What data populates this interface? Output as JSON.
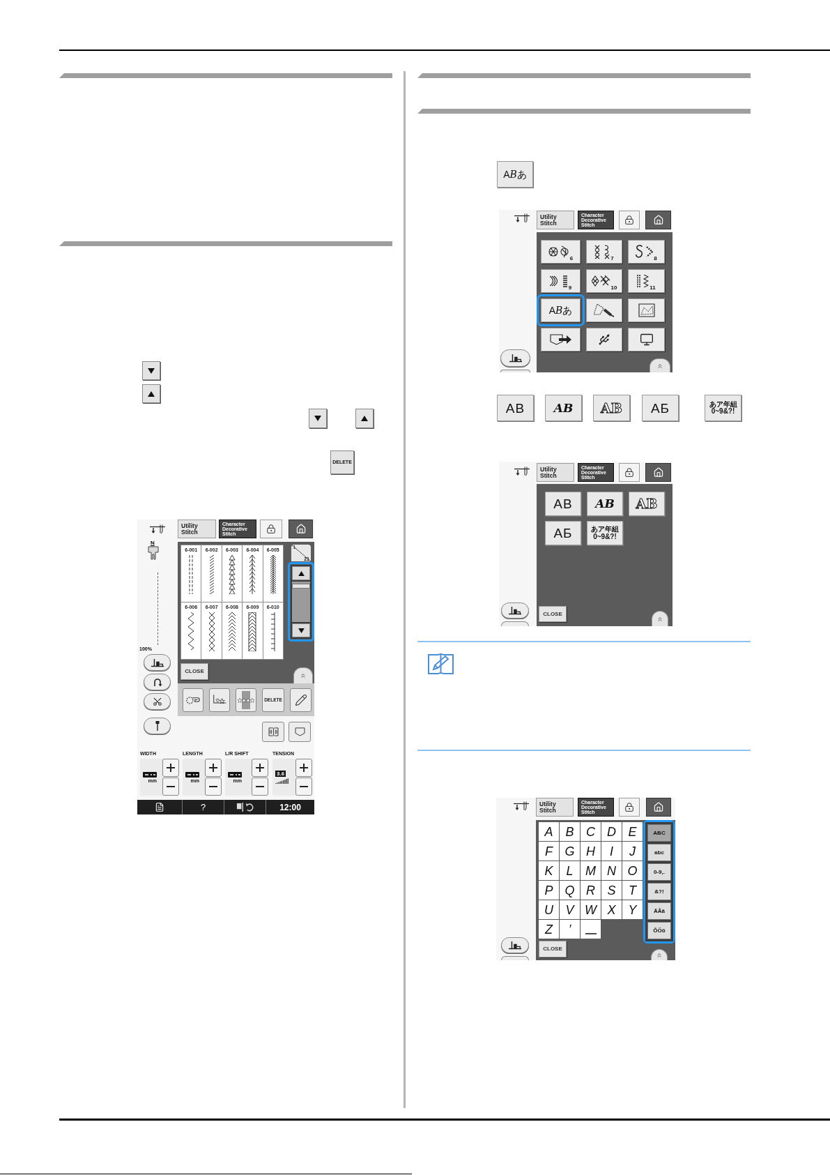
{
  "left_column": {
    "delete_key": "DELETE"
  },
  "stitch_screen": {
    "tabs": [
      {
        "lines": [
          "Utility",
          "Stitch"
        ],
        "selected": false
      },
      {
        "lines": [
          "Character",
          "Decorative",
          "Stitch"
        ],
        "selected": true
      }
    ],
    "presser_foot": "N",
    "zoom": "100%",
    "page": {
      "current": "1",
      "total": "21"
    },
    "stitches": [
      {
        "number": "6-001",
        "kind": "running"
      },
      {
        "number": "6-002",
        "kind": "rope"
      },
      {
        "number": "6-003",
        "kind": "chain"
      },
      {
        "number": "6-004",
        "kind": "feather"
      },
      {
        "number": "6-005",
        "kind": "arrow"
      },
      {
        "number": "6-006",
        "kind": "zigzag"
      },
      {
        "number": "6-007",
        "kind": "cross"
      },
      {
        "number": "6-008",
        "kind": "chevron"
      },
      {
        "number": "6-009",
        "kind": "boxed"
      },
      {
        "number": "6-010",
        "kind": "ladder"
      }
    ],
    "scroll_highlighted": true,
    "close": "CLOSE",
    "tool_delete": "DELETE",
    "settings": [
      {
        "label": "WIDTH",
        "kind": "blank",
        "unit": "mm"
      },
      {
        "label": "LENGTH",
        "kind": "blank",
        "unit": "mm"
      },
      {
        "label": "L/R SHIFT",
        "kind": "blank",
        "unit": "mm"
      },
      {
        "label": "TENSION",
        "kind": "tension",
        "value": "3.6"
      }
    ],
    "status_bar": {
      "help": "?",
      "time": "12:00"
    }
  },
  "category_key": {
    "parts": [
      {
        "text": "A",
        "kind": "plain"
      },
      {
        "text": "B",
        "kind": "script"
      },
      {
        "text": "あ",
        "kind": "plain"
      }
    ]
  },
  "category_screen": {
    "tabs": [
      {
        "lines": [
          "Utility",
          "Stitch"
        ],
        "selected": false
      },
      {
        "lines": [
          "Character",
          "Decorative",
          "Stitch"
        ],
        "selected": true
      }
    ],
    "categories": [
      {
        "kind": "motif",
        "number": "6",
        "highlighted": false
      },
      {
        "kind": "cross",
        "number": "7",
        "highlighted": false
      },
      {
        "kind": "scroll",
        "number": "8",
        "highlighted": false
      },
      {
        "kind": "satin",
        "number": "9",
        "highlighted": false
      },
      {
        "kind": "lattice",
        "number": "10",
        "highlighted": false
      },
      {
        "kind": "zigzag",
        "number": "11",
        "highlighted": false
      },
      {
        "kind": "characters",
        "parts": [
          {
            "text": "A",
            "kind": "plain"
          },
          {
            "text": "B",
            "kind": "script"
          },
          {
            "text": "あ",
            "kind": "plain"
          }
        ],
        "highlighted": true
      },
      {
        "kind": "pen",
        "highlighted": false
      },
      {
        "kind": "picture",
        "highlighted": false
      },
      {
        "kind": "pocket",
        "highlighted": false
      },
      {
        "kind": "usb",
        "highlighted": false
      },
      {
        "kind": "computer",
        "highlighted": false
      }
    ]
  },
  "font_keys": [
    {
      "kind": "sans",
      "lines": [
        "AB"
      ]
    },
    {
      "kind": "script",
      "lines": [
        "AB"
      ]
    },
    {
      "kind": "outline",
      "lines": [
        "AB"
      ]
    },
    {
      "kind": "sans",
      "lines": [
        "АБ"
      ]
    },
    {
      "kind": "small",
      "lines": [
        "あア年組",
        "0~9&?!"
      ]
    }
  ],
  "font_screen": {
    "tabs": [
      {
        "lines": [
          "Utility",
          "Stitch"
        ],
        "selected": false
      },
      {
        "lines": [
          "Character",
          "Decorative",
          "Stitch"
        ],
        "selected": true
      }
    ],
    "fonts": [
      {
        "kind": "sans",
        "lines": [
          "AB"
        ]
      },
      {
        "kind": "script",
        "lines": [
          "AB"
        ]
      },
      {
        "kind": "outline",
        "lines": [
          "AB"
        ]
      },
      {
        "kind": "sans",
        "lines": [
          "АБ"
        ]
      },
      {
        "kind": "small",
        "lines": [
          "あア年組",
          "0~9&?!"
        ]
      }
    ],
    "close": "CLOSE"
  },
  "letter_screen": {
    "tabs": [
      {
        "lines": [
          "Utility",
          "Stitch"
        ],
        "selected": false
      },
      {
        "lines": [
          "Character",
          "Decorative",
          "Stitch"
        ],
        "selected": true
      }
    ],
    "keys": [
      {
        "kind": "char",
        "label": "A"
      },
      {
        "kind": "char",
        "label": "B"
      },
      {
        "kind": "char",
        "label": "C"
      },
      {
        "kind": "char",
        "label": "D"
      },
      {
        "kind": "char",
        "label": "E"
      },
      {
        "kind": "char",
        "label": "F"
      },
      {
        "kind": "char",
        "label": "G"
      },
      {
        "kind": "char",
        "label": "H"
      },
      {
        "kind": "char",
        "label": "I"
      },
      {
        "kind": "char",
        "label": "J"
      },
      {
        "kind": "char",
        "label": "K"
      },
      {
        "kind": "char",
        "label": "L"
      },
      {
        "kind": "char",
        "label": "M"
      },
      {
        "kind": "char",
        "label": "N"
      },
      {
        "kind": "char",
        "label": "O"
      },
      {
        "kind": "char",
        "label": "P"
      },
      {
        "kind": "char",
        "label": "Q"
      },
      {
        "kind": "char",
        "label": "R"
      },
      {
        "kind": "char",
        "label": "S"
      },
      {
        "kind": "char",
        "label": "T"
      },
      {
        "kind": "char",
        "label": "U"
      },
      {
        "kind": "char",
        "label": "V"
      },
      {
        "kind": "char",
        "label": "W"
      },
      {
        "kind": "char",
        "label": "X"
      },
      {
        "kind": "char",
        "label": "Y"
      },
      {
        "kind": "char",
        "label": "Z"
      },
      {
        "kind": "char",
        "label": "’"
      },
      {
        "kind": "space"
      }
    ],
    "types": [
      {
        "label": "ABC",
        "selected": true
      },
      {
        "label": "abc",
        "selected": false
      },
      {
        "label": "0-9,.",
        "selected": false
      },
      {
        "label": "&?!",
        "selected": false
      },
      {
        "label": "ÄÅä",
        "selected": false
      },
      {
        "label": "ÕÖö",
        "selected": false
      }
    ],
    "types_highlighted": true,
    "close": "CLOSE"
  }
}
